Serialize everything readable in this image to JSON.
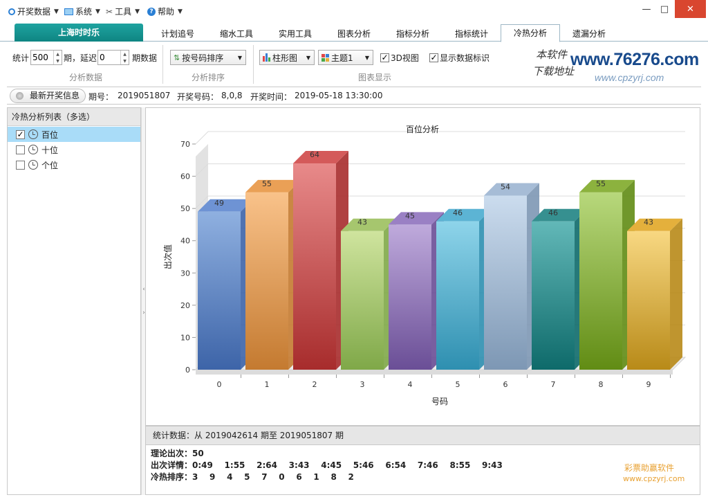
{
  "menu": {
    "items": [
      {
        "label": "开奖数据",
        "icon": "circle-icon"
      },
      {
        "label": "系统",
        "icon": "monitor-icon"
      },
      {
        "label": "工具",
        "icon": "tools-icon"
      },
      {
        "label": "帮助",
        "icon": "help-icon"
      }
    ],
    "window_controls": {
      "minimize": "—",
      "maximize": "□",
      "close": "✕"
    }
  },
  "tabs": {
    "brand": "上海时时乐",
    "items": [
      "计划追号",
      "缩水工具",
      "实用工具",
      "图表分析",
      "指标分析",
      "指标统计",
      "冷热分析",
      "遗漏分析"
    ],
    "active": "冷热分析"
  },
  "toolbar": {
    "stat_label": "统计",
    "stat_value": "500",
    "period_label": "期，延迟",
    "delay_value": "0",
    "period_data_label": "期数据",
    "group1_caption": "分析数据",
    "sort_combo": "按号码排序",
    "group2_caption": "分析排序",
    "chart_type_combo": "柱形图",
    "theme_combo": "主题1",
    "view3d_label": "3D视图",
    "view3d_checked": true,
    "show_labels_label": "显示数据标识",
    "show_labels_checked": true,
    "group3_caption": "图表显示"
  },
  "logo": {
    "line1": "本软件",
    "line2": "下载地址",
    "site": "www.76276.com",
    "site_sub": "www.cpzyrj.com"
  },
  "info": {
    "title": "最新开奖信息",
    "period_label": "期号：",
    "period_value": "2019051807",
    "numbers_label": "开奖号码：",
    "numbers_value": "8,0,8",
    "time_label": "开奖时间：",
    "time_value": "2019-05-18 13:30:00"
  },
  "leftpanel": {
    "header": "冷热分析列表（多选）",
    "items": [
      {
        "label": "百位",
        "checked": true,
        "selected": true
      },
      {
        "label": "十位",
        "checked": false,
        "selected": false
      },
      {
        "label": "个位",
        "checked": false,
        "selected": false
      }
    ]
  },
  "chart_data": {
    "type": "bar",
    "title": "百位分析",
    "xlabel": "号码",
    "ylabel": "出次值",
    "categories": [
      "0",
      "1",
      "2",
      "3",
      "4",
      "5",
      "6",
      "7",
      "8",
      "9"
    ],
    "values": [
      49,
      55,
      64,
      43,
      45,
      46,
      54,
      46,
      55,
      43
    ],
    "ylim": [
      0,
      70
    ],
    "yticks": [
      "0",
      "10",
      "20",
      "30",
      "40",
      "50",
      "60",
      "70"
    ],
    "three_d": true,
    "grid": true,
    "colors": [
      [
        "#8fb0e0",
        "#3d64a8",
        "#6e93d4"
      ],
      [
        "#f9c28a",
        "#c47a30",
        "#eaa056"
      ],
      [
        "#e88a8a",
        "#a72c2c",
        "#d45a5a"
      ],
      [
        "#cfe49e",
        "#7fa848",
        "#a6c66e"
      ],
      [
        "#bfaadc",
        "#6a4e96",
        "#9a80c4"
      ],
      [
        "#8ed4ea",
        "#2e8fb0",
        "#5cb4d4"
      ],
      [
        "#cbdcee",
        "#7d97b4",
        "#a6bcd6"
      ],
      [
        "#62b8b8",
        "#0e6a6a",
        "#369090"
      ],
      [
        "#b8d87c",
        "#618c14",
        "#8cb23e"
      ],
      [
        "#f8d882",
        "#b88a18",
        "#e4b03c"
      ]
    ]
  },
  "stats": {
    "header": "统计数据：从 2019042614 期至 2019051807 期",
    "theory": "理论出次：50",
    "detail": "出次详情：0:49    1:55    2:64    3:43    4:45    5:46    6:54    7:46    8:55    9:43",
    "rank": "冷热排序：3    9    4    5    7    0    6    1    8    2",
    "watermark": "彩票助赢软件",
    "watermark_url": "www.cpzyrj.com"
  }
}
